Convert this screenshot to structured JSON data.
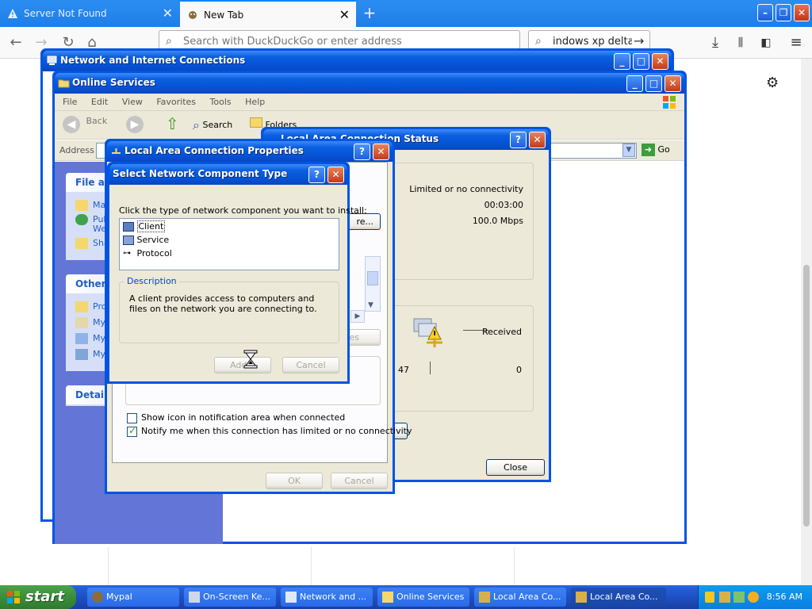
{
  "firefox": {
    "tabs": [
      {
        "title": "Server Not Found",
        "close": "✕"
      },
      {
        "title": "New Tab",
        "close": "✕"
      }
    ],
    "new_tab": "+",
    "url_placeholder": "Search with DuckDuckGo or enter address",
    "search_value": "indows xp delta",
    "window_controls": {
      "min": "–",
      "max": "❐",
      "close": "✕"
    }
  },
  "net_window": {
    "title": "Network and Internet Connections",
    "controls": {
      "min": "_",
      "max": "□",
      "close": "✕"
    }
  },
  "online_services": {
    "title": "Online Services",
    "controls": {
      "min": "_",
      "max": "□",
      "close": "✕"
    },
    "menu": [
      "File",
      "Edit",
      "View",
      "Favorites",
      "Tools",
      "Help"
    ],
    "toolbar": {
      "back": "Back",
      "search": "Search",
      "folders": "Folders"
    },
    "address_label": "Address",
    "go_label": "Go",
    "taskpane": {
      "file_header": "File an",
      "file_items": [
        "Ma",
        "Pul",
        "We",
        "Sha"
      ],
      "other_header": "Other l",
      "other_items": [
        "Pro",
        "My",
        "My",
        "My"
      ],
      "details_header": "Details"
    }
  },
  "status_window": {
    "title": "Local Area Connection Status",
    "connectivity": "Limited or no connectivity",
    "duration": "00:03:00",
    "speed": "100.0 Mbps",
    "received_label": "Received",
    "sent_value": "47",
    "received_value": "0",
    "close_button": "Close"
  },
  "properties": {
    "title": "Local Area Connection Properties",
    "configure_button": "re...",
    "properties_button": "es",
    "show_icon": "Show icon in notification area when connected",
    "notify": "Notify me when this connection has limited or no connectivity",
    "show_icon_checked": false,
    "notify_checked": true,
    "ok": "OK",
    "cancel": "Cancel"
  },
  "select_dialog": {
    "title": "Select Network Component Type",
    "instruction": "Click the type of network component you want to install:",
    "items": [
      "Client",
      "Service",
      "Protocol"
    ],
    "description_label": "Description",
    "description": "A client provides access to computers and files on the network you are connecting to.",
    "add": "Add...",
    "cancel": "Cancel"
  },
  "taskbar": {
    "start": "start",
    "items": [
      "Mypal",
      "On-Screen Ke...",
      "Network and ...",
      "Online Services",
      "Local Area Co...",
      "Local Area Co..."
    ],
    "clock": "8:56 AM"
  }
}
